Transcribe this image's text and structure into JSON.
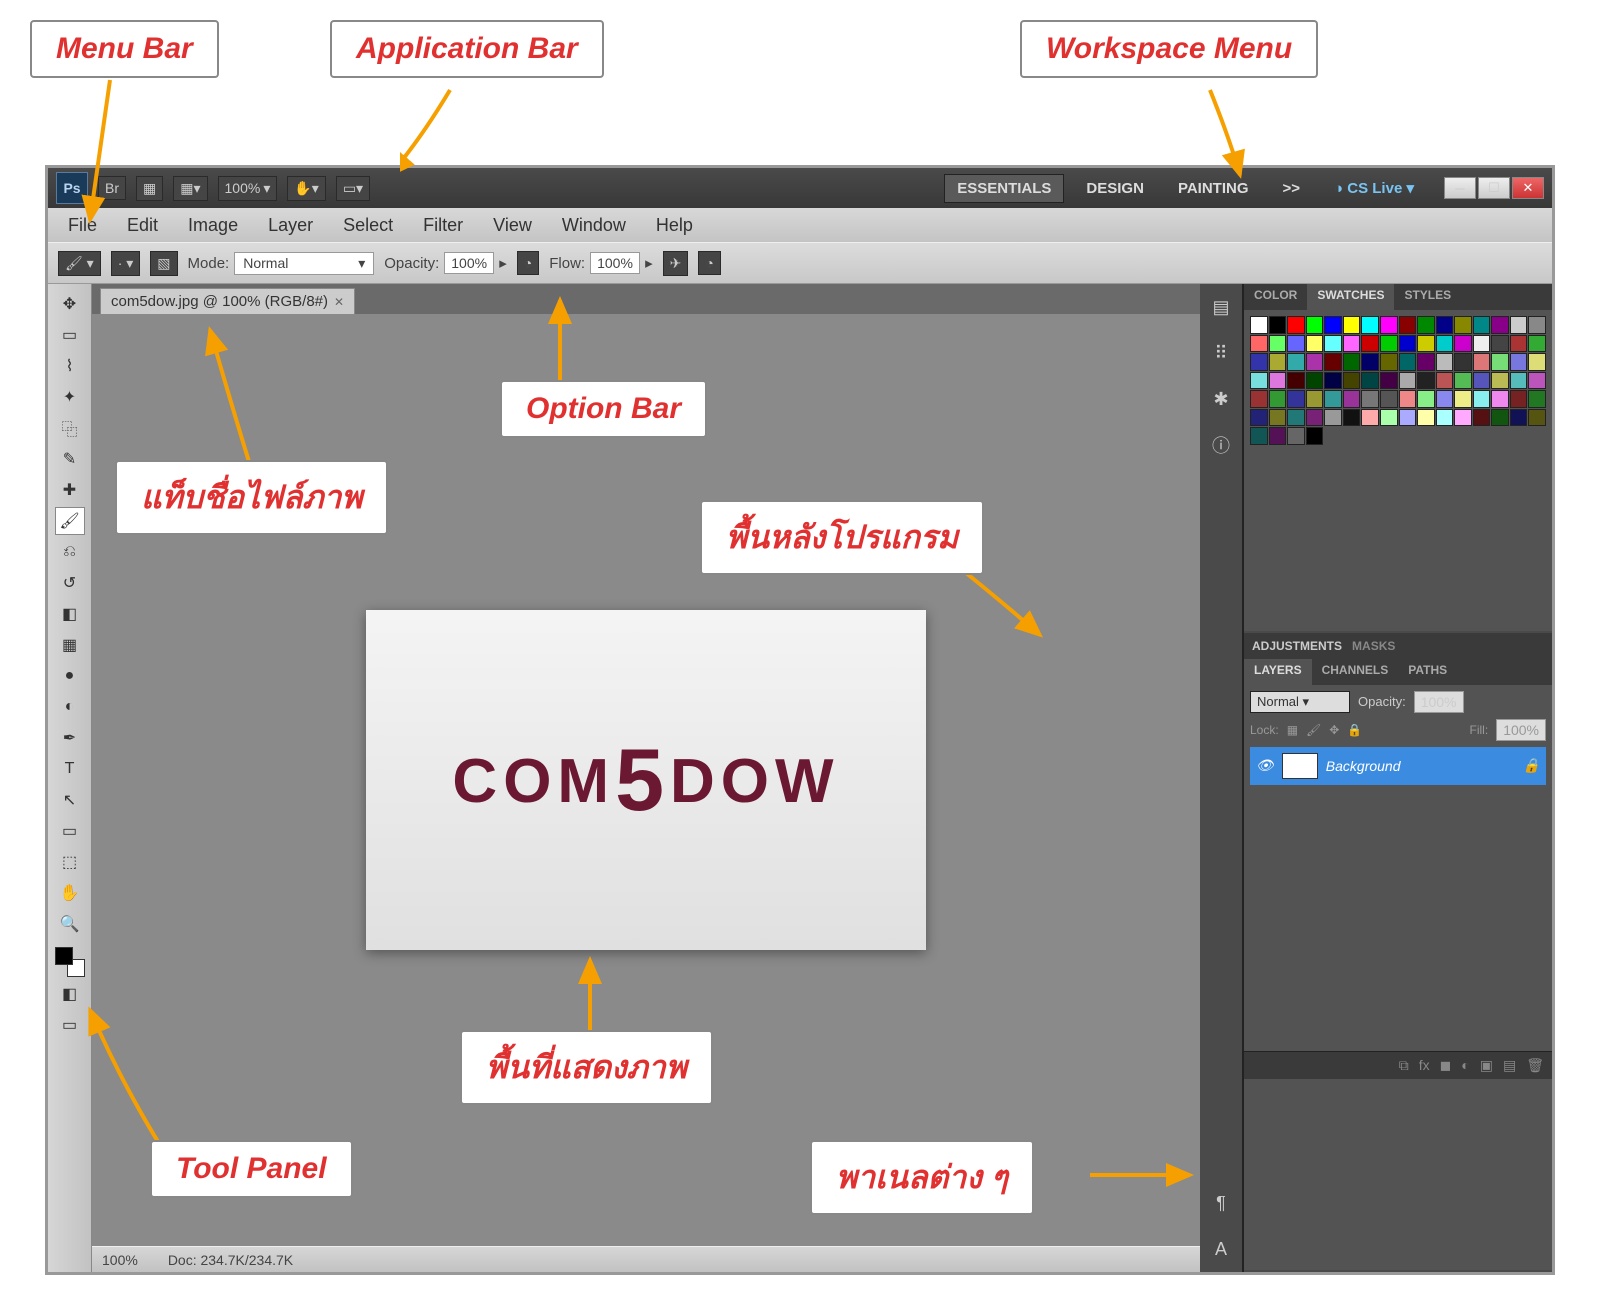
{
  "annotations": {
    "menu_bar": "Menu Bar",
    "application_bar": "Application Bar",
    "workspace_menu": "Workspace Menu",
    "option_bar": "Option Bar",
    "file_tab": "แท็บชื่อไฟล์ภาพ",
    "background": "พื้นหลังโปรแกรม",
    "tool_panel": "Tool Panel",
    "canvas_area": "พื้นที่แสดงภาพ",
    "panels": "พาเนลต่าง ๆ"
  },
  "app_bar": {
    "logo": "Ps",
    "zoom": "100%",
    "workspace_tabs": [
      "ESSENTIALS",
      "DESIGN",
      "PAINTING"
    ],
    "more": ">>",
    "cslive": "CS Live"
  },
  "menu": [
    "File",
    "Edit",
    "Image",
    "Layer",
    "Select",
    "Filter",
    "View",
    "Window",
    "Help"
  ],
  "option_bar": {
    "mode_label": "Mode:",
    "mode_value": "Normal",
    "opacity_label": "Opacity:",
    "opacity_value": "100%",
    "flow_label": "Flow:",
    "flow_value": "100%"
  },
  "doc_tab": "com5dow.jpg @ 100% (RGB/8#)",
  "canvas_text_a": "COM",
  "canvas_text_5": "5",
  "canvas_text_b": "DOW",
  "status": {
    "zoom": "100%",
    "doc": "Doc: 234.7K/234.7K"
  },
  "right": {
    "color_tabs": [
      "COLOR",
      "SWATCHES",
      "STYLES"
    ],
    "adjustments": "ADJUSTMENTS",
    "masks": "MASKS",
    "layer_tabs": [
      "LAYERS",
      "CHANNELS",
      "PATHS"
    ],
    "blend": "Normal",
    "opacity_lbl": "Opacity:",
    "opacity_val": "100%",
    "lock_lbl": "Lock:",
    "fill_lbl": "Fill:",
    "fill_val": "100%",
    "bg_layer": "Background"
  },
  "swatch_colors": [
    "#fff",
    "#000",
    "#f00",
    "#0f0",
    "#00f",
    "#ff0",
    "#0ff",
    "#f0f",
    "#800",
    "#080",
    "#008",
    "#880",
    "#088",
    "#808",
    "#ccc",
    "#888",
    "#f66",
    "#6f6",
    "#66f",
    "#ff6",
    "#6ff",
    "#f6f",
    "#c00",
    "#0c0",
    "#00c",
    "#cc0",
    "#0cc",
    "#c0c",
    "#eee",
    "#444",
    "#a33",
    "#3a3",
    "#33a",
    "#aa3",
    "#3aa",
    "#a3a",
    "#600",
    "#060",
    "#006",
    "#660",
    "#066",
    "#606",
    "#bbb",
    "#333",
    "#d77",
    "#7d7",
    "#77d",
    "#dd7",
    "#7dd",
    "#d7d",
    "#400",
    "#040",
    "#004",
    "#440",
    "#044",
    "#404",
    "#aaa",
    "#222",
    "#b55",
    "#5b5",
    "#55b",
    "#bb5",
    "#5bb",
    "#b5b",
    "#933",
    "#393",
    "#339",
    "#993",
    "#399",
    "#939",
    "#777",
    "#555",
    "#e88",
    "#8e8",
    "#88e",
    "#ee8",
    "#8ee",
    "#e8e",
    "#722",
    "#272",
    "#227",
    "#772",
    "#277",
    "#727",
    "#999",
    "#111",
    "#faa",
    "#afa",
    "#aaf",
    "#ffa",
    "#aff",
    "#faf",
    "#511",
    "#151",
    "#115",
    "#551",
    "#155",
    "#515",
    "#666",
    "#000"
  ]
}
